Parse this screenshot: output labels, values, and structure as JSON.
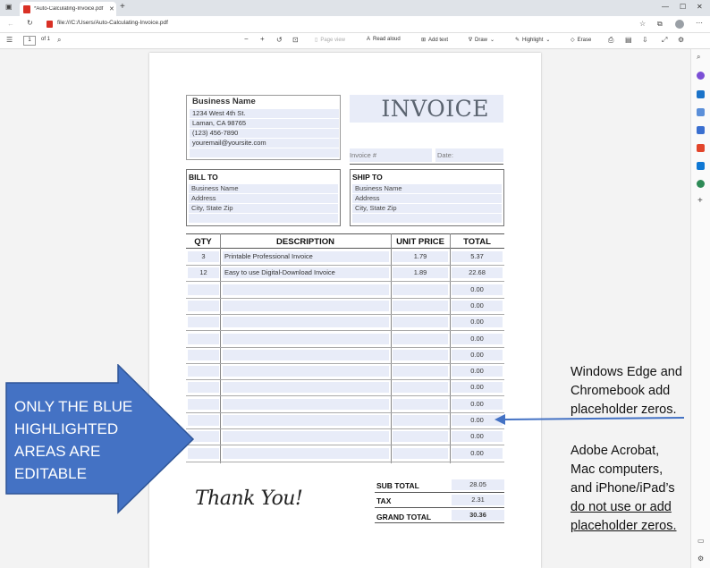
{
  "browser": {
    "tab_title": "*Auto-Calculating-Invoice.pdf",
    "url": "file:///C:/Users/Auto-Calculating-Invoice.pdf"
  },
  "pdf_toolbar": {
    "page_current": "1",
    "page_total": "of 1",
    "page_view": "Page view",
    "read_aloud": "Read aloud",
    "add_text": "Add text",
    "draw": "Draw",
    "highlight": "Highlight",
    "erase": "Erase"
  },
  "invoice": {
    "business": {
      "name": "Business Name",
      "lines": [
        "1234 West 4th St.",
        "Laman, CA 98765",
        "(123) 456-7890",
        "youremail@yoursite.com"
      ]
    },
    "title": "INVOICE",
    "invoice_no_label": "Invoice #",
    "date_label": "Date:",
    "bill_to": {
      "heading": "BILL TO",
      "lines": [
        "Business Name",
        "Address",
        "City, State Zip"
      ]
    },
    "ship_to": {
      "heading": "SHIP TO",
      "lines": [
        "Business Name",
        "Address",
        "City, State Zip"
      ]
    },
    "table": {
      "headers": [
        "QTY",
        "DESCRIPTION",
        "UNIT PRICE",
        "TOTAL"
      ],
      "rows": [
        [
          "3",
          "Printable Professional Invoice",
          "1.79",
          "5.37"
        ],
        [
          "12",
          "Easy to use Digital-Download Invoice",
          "1.89",
          "22.68"
        ],
        [
          "",
          "",
          "",
          "0.00"
        ],
        [
          "",
          "",
          "",
          "0.00"
        ],
        [
          "",
          "",
          "",
          "0.00"
        ],
        [
          "",
          "",
          "",
          "0.00"
        ],
        [
          "",
          "",
          "",
          "0.00"
        ],
        [
          "",
          "",
          "",
          "0.00"
        ],
        [
          "",
          "",
          "",
          "0.00"
        ],
        [
          "",
          "",
          "",
          "0.00"
        ],
        [
          "",
          "",
          "",
          "0.00"
        ],
        [
          "",
          "",
          "",
          "0.00"
        ],
        [
          "",
          "",
          "",
          "0.00"
        ]
      ]
    },
    "totals": {
      "subtotal_label": "SUB TOTAL",
      "subtotal": "28.05",
      "tax_label": "TAX",
      "tax": "2.31",
      "grand_label": "GRAND TOTAL",
      "grand": "30.36"
    },
    "thank_you": "Thank You!"
  },
  "annotations": {
    "arrow_text": [
      "ONLY THE BLUE",
      "HIGHLIGHTED",
      "AREAS ARE",
      "EDITABLE"
    ],
    "note1": [
      "Windows Edge and",
      "Chromebook add",
      "placeholder zeros."
    ],
    "note2_lines": [
      "Adobe Acrobat,",
      "Mac computers,",
      "and iPhone/iPad’s"
    ],
    "note2_underlined": [
      "do not use or add",
      "placeholder zeros."
    ]
  },
  "colors": {
    "field_blue": "#e8ecf8",
    "arrow_blue": "#4472c4",
    "highlight_tab": "#d93025"
  }
}
